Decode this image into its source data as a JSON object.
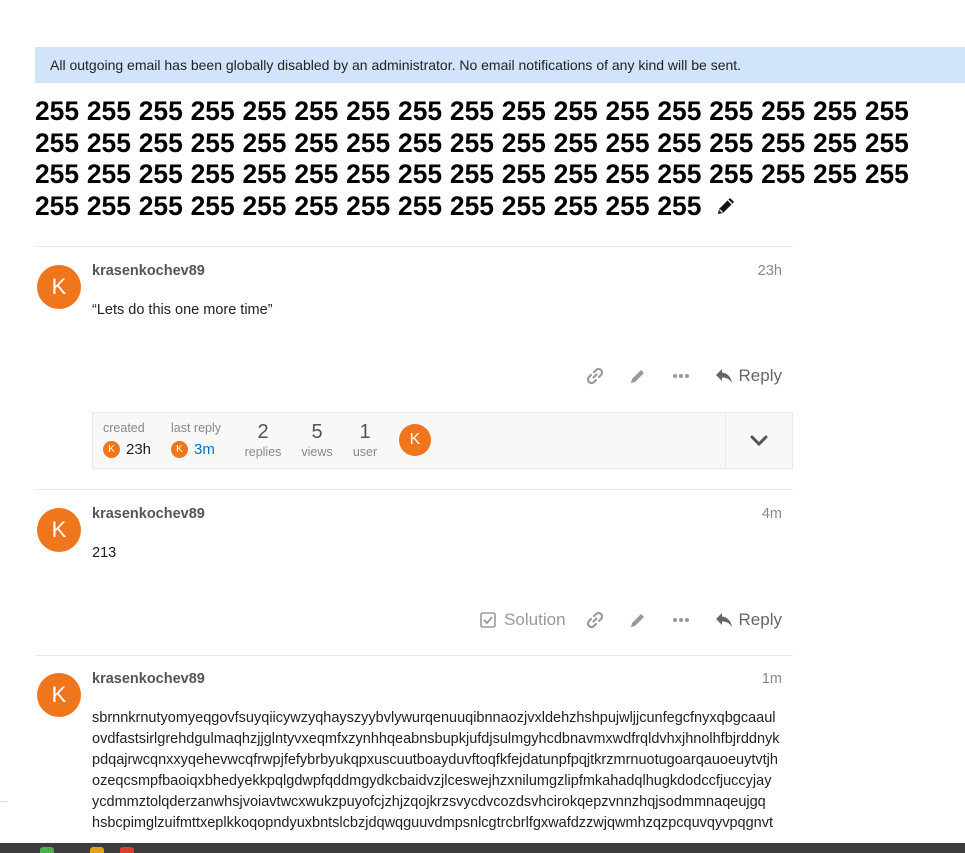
{
  "banner": {
    "text": "All outgoing email has been globally disabled by an administrator. No email notifications of any kind will be sent."
  },
  "topic": {
    "title": "255 255 255 255 255 255 255 255 255 255 255 255 255 255 255 255 255 255 255 255 255 255 255 255 255 255 255 255 255 255 255 255 255 255 255 255 255 255 255 255 255 255 255 255 255 255 255 255 255 255 255 255 255 255 255 255 255 255 255 255 255 255 255 255",
    "edit_icon": "pencil-icon"
  },
  "posts": [
    {
      "avatar_letter": "K",
      "username": "krasenkochev89",
      "date": "23h",
      "body": "“Lets do this one more time”",
      "reply_label": "Reply"
    },
    {
      "avatar_letter": "K",
      "username": "krasenkochev89",
      "date": "4m",
      "body": "213",
      "solution_label": "Solution",
      "reply_label": "Reply"
    },
    {
      "avatar_letter": "K",
      "username": "krasenkochev89",
      "date": "1m",
      "body_lines": [
        "sbrnnkrnutyomyeqgovfsuyqiicywzyqhayszyybvlywurqenuuqibnnaozjvxldehzhshpujwljjcunfegcfnyxqbgcaaul",
        "ovdfastsirlgrehdgulmaqhzjjglntyvxeqmfxzynhhqeabnsbupkjufdjsulmgyhcdbnavmxwdfrqldvhxjhnolhfbjrddnyk",
        "pdqajrwcqnxxyqehevwcqfrwpjfefybrbyukqpxuscuutboayduvftoqfkfejdatunpfpqjtkrzmrnuotugoarqauoeuytvtjh",
        "ozeqcsmpfbaoiqxbhedyekkpqlgdwpfqddmgydkcbaidvzjlceswejhzxnilumgzlipfmkahadqlhugkdodccfjuccyjay",
        "ycdmmztolqderzanwhsjvoiavtwcxwukzpuyofcjzhjzqojkrzsvycdvcozdsvhcirokqepzvnnzhqjsodmmnaqeujgq",
        "hsbcpimglzuifmttxeplkkoqopndyuxbntslcbzjdqwqguuvdmpsnlcgtrcbrlfgxwafdzzwjqwmhzqzpcquvqyvpqgnvt"
      ]
    }
  ],
  "topic_map": {
    "created_label": "created",
    "created_avatar": "K",
    "created_value": "23h",
    "last_reply_label": "last reply",
    "last_reply_avatar": "K",
    "last_reply_value": "3m",
    "replies_count": "2",
    "replies_label": "replies",
    "views_count": "5",
    "views_label": "views",
    "users_count": "1",
    "users_label": "user",
    "participant_avatar": "K"
  },
  "colors": {
    "banner_bg": "#d1e4fb",
    "avatar": "#f0761e",
    "link": "#0a6fc2",
    "icon": "#999999"
  }
}
